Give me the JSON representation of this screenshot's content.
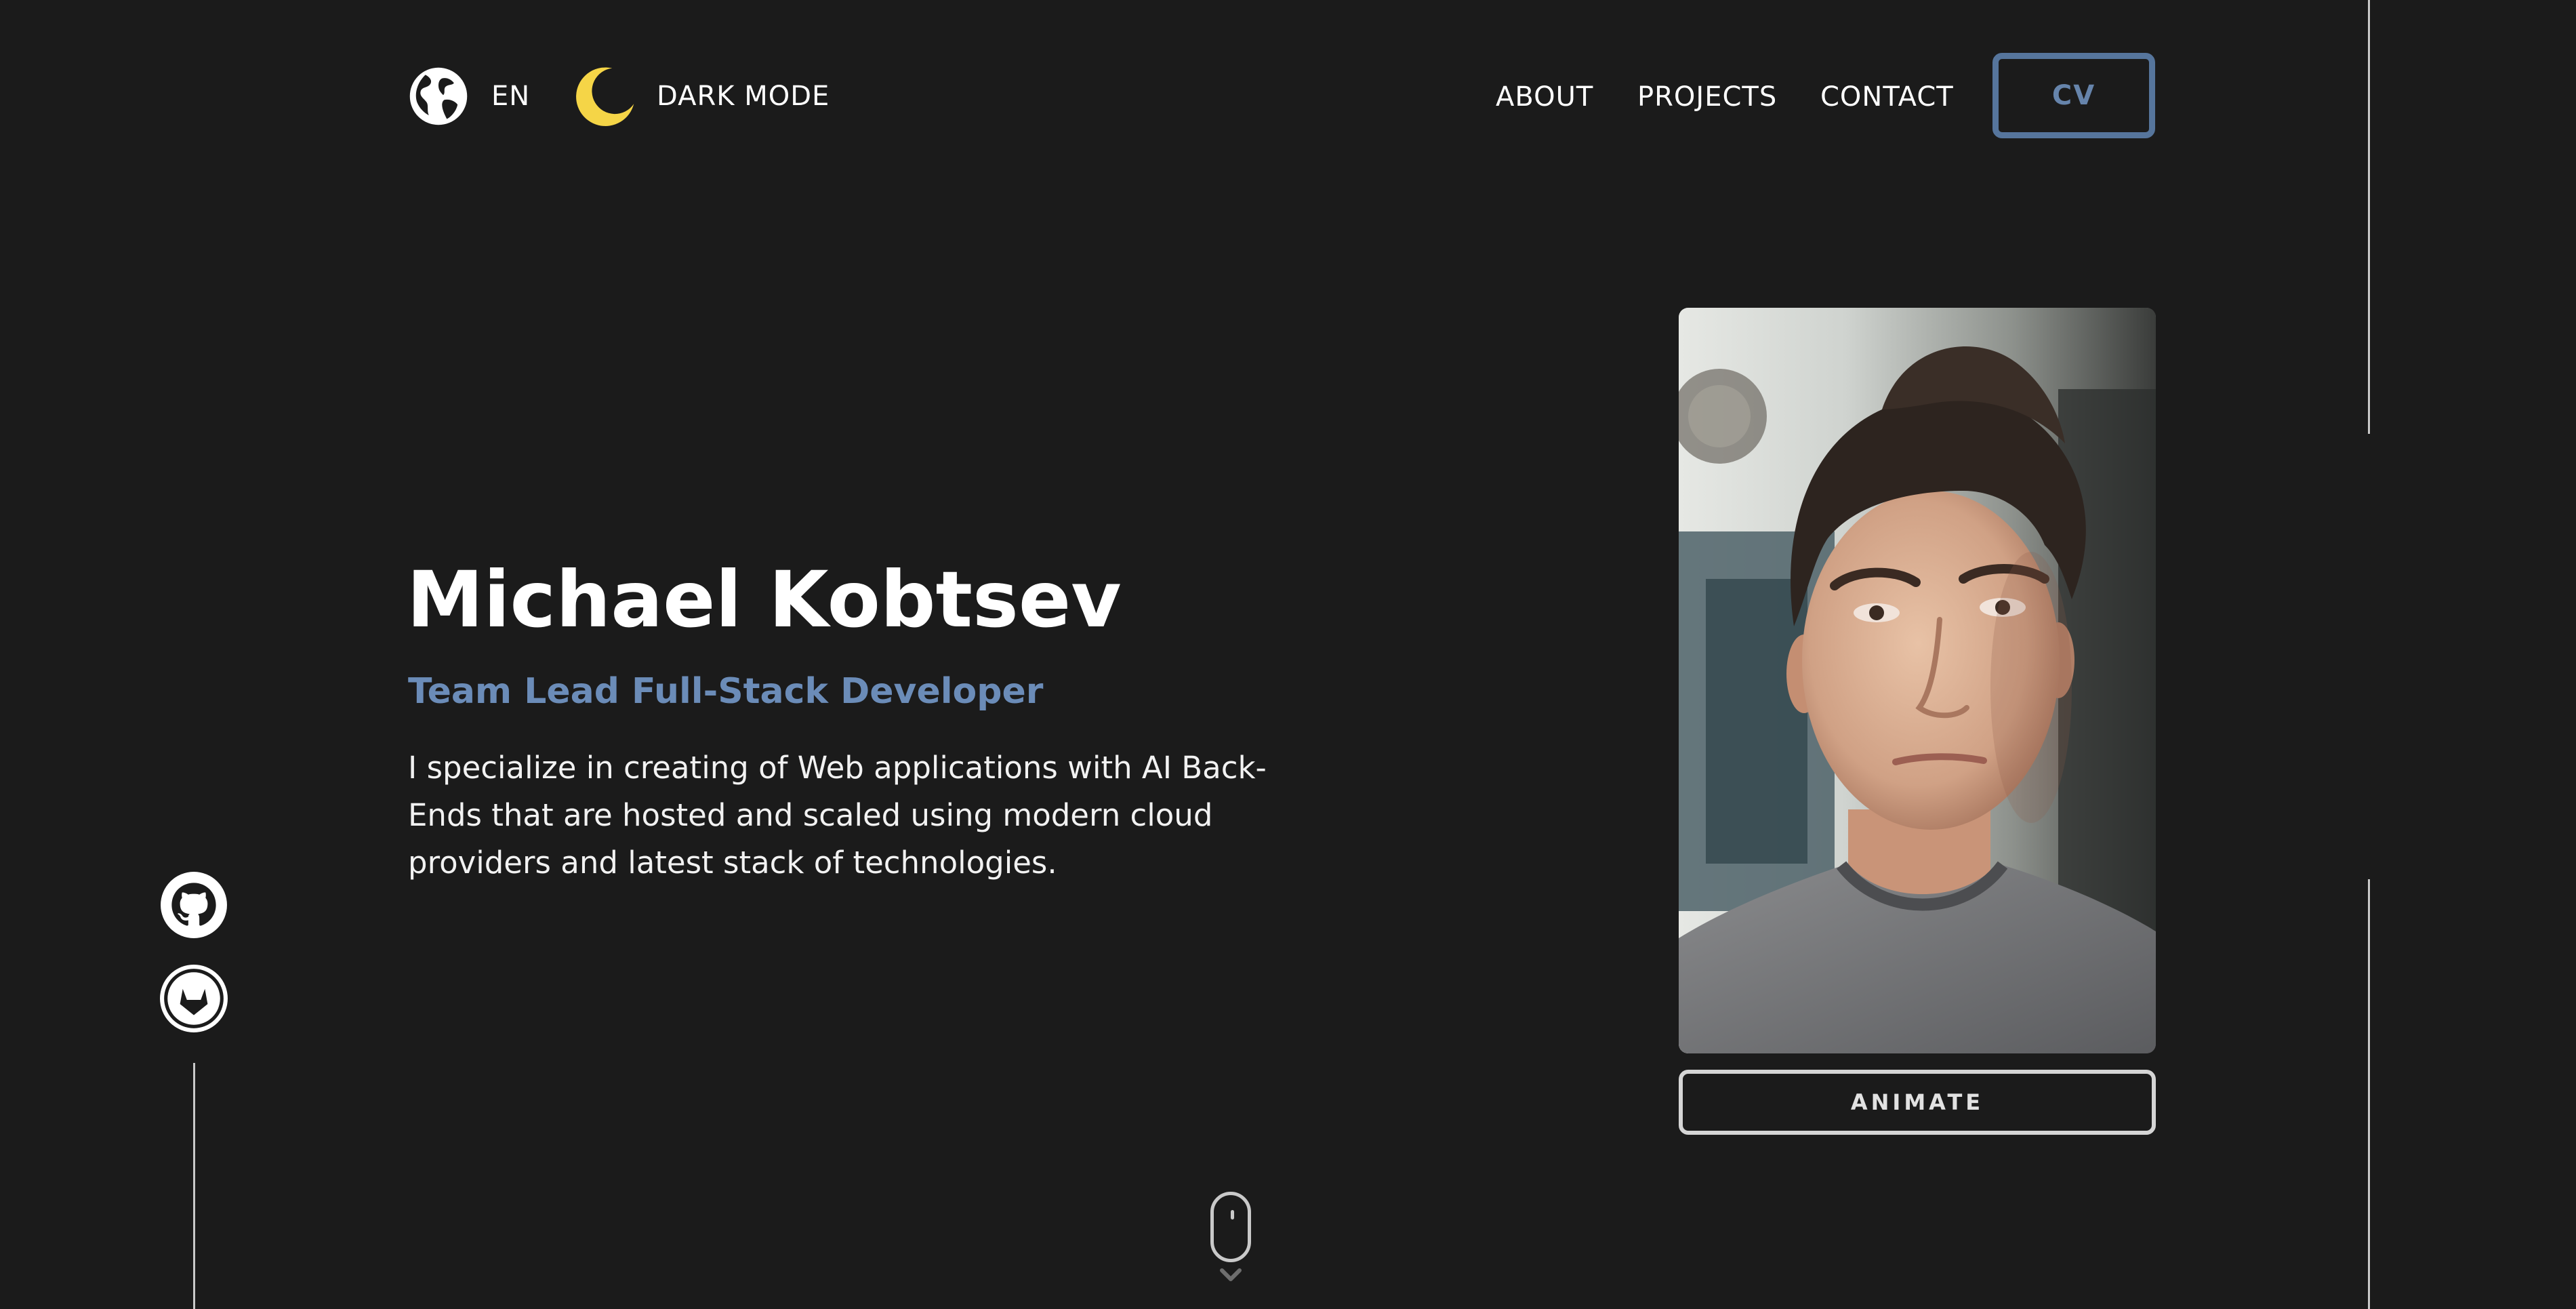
{
  "header": {
    "language": {
      "icon": "globe-icon",
      "label": "EN"
    },
    "theme_toggle": {
      "icon": "moon-icon",
      "label": "DARK MODE",
      "icon_color": "#f5d547"
    },
    "nav": {
      "about": "ABOUT",
      "projects": "PROJECTS",
      "contact": "CONTACT"
    },
    "cv_button": {
      "label": "CV",
      "accent": "#56759c"
    }
  },
  "hero": {
    "name": "Michael Kobtsev",
    "role": "Team Lead Full-Stack Developer",
    "role_color": "#6b8cb8",
    "description": "I specialize in creating of Web applications with AI Back-Ends that are hosted and scaled using modern cloud providers and latest stack of technologies."
  },
  "portrait": {
    "animate_label": "ANIMATE"
  },
  "social": [
    {
      "icon": "github-icon"
    },
    {
      "icon": "gitlab-icon"
    }
  ],
  "scroll_indicator": {
    "icon": "mouse-scroll-icon"
  },
  "colors": {
    "background": "#1b1b1b",
    "text": "#ffffff",
    "accent": "#56759c"
  }
}
